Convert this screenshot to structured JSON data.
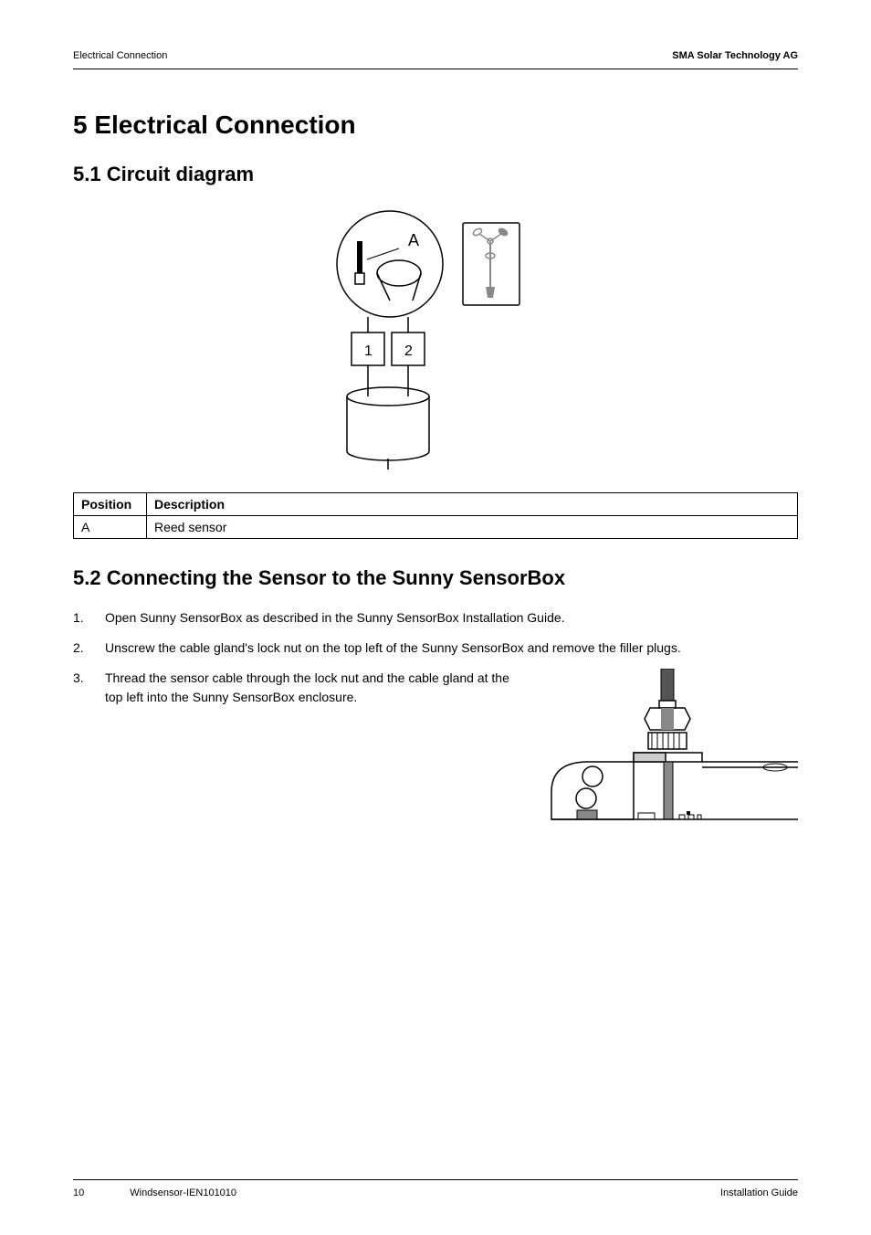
{
  "header": {
    "left": "Electrical Connection",
    "right": "SMA Solar Technology AG"
  },
  "section5": {
    "title": "5 Electrical Connection"
  },
  "section51": {
    "title": "5.1 Circuit diagram"
  },
  "table": {
    "header_position": "Position",
    "header_description": "Description",
    "row1_position": "A",
    "row1_description": "Reed sensor"
  },
  "section52": {
    "title": "5.2 Connecting the Sensor to the Sunny SensorBox",
    "step1_num": "1.",
    "step1_text": "Open Sunny SensorBox as described in the Sunny SensorBox Installation Guide.",
    "step2_num": "2.",
    "step2_text": "Unscrew the cable gland's lock nut on the top left of the Sunny SensorBox and remove the filler plugs.",
    "step3_num": "3.",
    "step3_text": "Thread the sensor cable through the lock nut and the cable gland at the top left into the Sunny SensorBox enclosure."
  },
  "footer": {
    "page": "10",
    "docid": "Windsensor-IEN101010",
    "doctype": "Installation Guide"
  }
}
